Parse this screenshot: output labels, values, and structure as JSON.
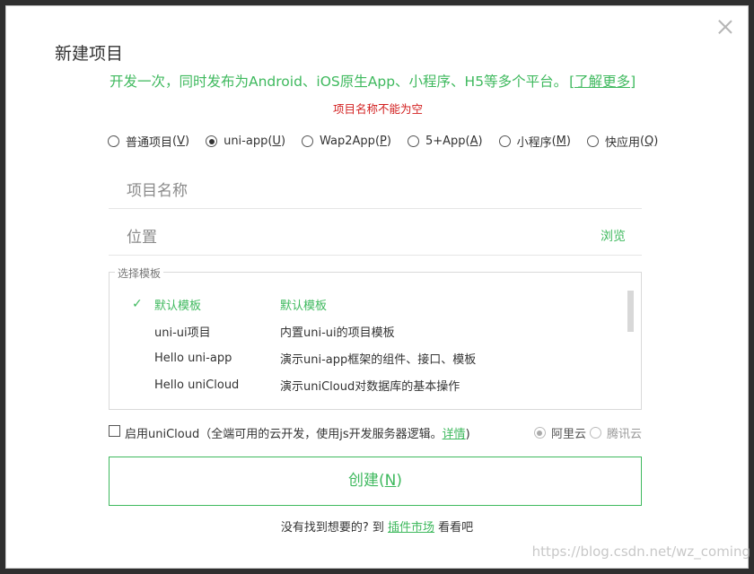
{
  "dialog": {
    "title": "新建项目",
    "subtitle": "开发一次，同时发布为Android、iOS原生App、小程序、H5等多个平台。",
    "learn_more": "[了解更多]",
    "error": "项目名称不能为空"
  },
  "project_types": [
    {
      "label": "普通项目",
      "key": "V",
      "selected": false
    },
    {
      "label": "uni-app",
      "key": "U",
      "selected": true
    },
    {
      "label": "Wap2App",
      "key": "P",
      "selected": false
    },
    {
      "label": "5+App",
      "key": "A",
      "selected": false
    },
    {
      "label": "小程序",
      "key": "M",
      "selected": false
    },
    {
      "label": "快应用",
      "key": "Q",
      "selected": false
    }
  ],
  "fields": {
    "name_placeholder": "项目名称",
    "location_placeholder": "位置",
    "browse": "浏览"
  },
  "templates": {
    "legend": "选择模板",
    "items": [
      {
        "name": "默认模板",
        "desc": "默认模板",
        "selected": true
      },
      {
        "name": "uni-ui项目",
        "desc": "内置uni-ui的项目模板",
        "selected": false
      },
      {
        "name": "Hello uni-app",
        "desc": "演示uni-app框架的组件、接口、模板",
        "selected": false
      },
      {
        "name": "Hello uniCloud",
        "desc": "演示uniCloud对数据库的基本操作",
        "selected": false
      }
    ]
  },
  "unicloud": {
    "label": "启用uniCloud（全端可用的云开发，使用js开发服务器逻辑。",
    "details": "详情",
    "close_paren": ")",
    "providers": [
      {
        "label": "阿里云",
        "selected": true
      },
      {
        "label": "腾讯云",
        "selected": false
      }
    ]
  },
  "create_button": {
    "label": "创建(",
    "key": "N",
    "suffix": ")"
  },
  "footer": {
    "prefix": "没有找到想要的? 到 ",
    "link": "插件市场",
    "suffix": " 看看吧"
  },
  "watermark": "https://blog.csdn.net/wz_coming",
  "colors": {
    "accent": "#3fb95e",
    "error": "#d21f1f"
  }
}
